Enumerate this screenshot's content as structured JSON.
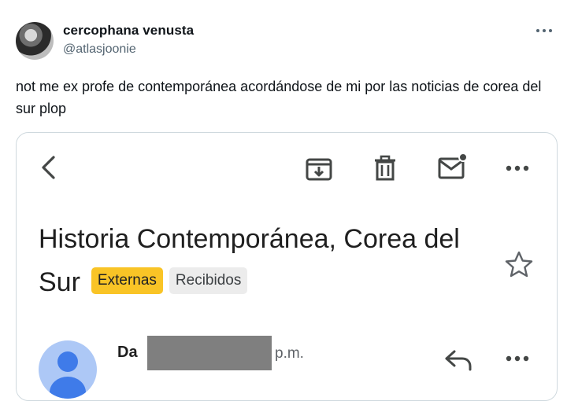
{
  "tweet": {
    "display_name": "cercophana venusta",
    "handle": "@atlasjoonie",
    "text": "not me ex profe de contemporánea acordándose de mi por las noticias de corea del sur plop"
  },
  "email": {
    "subject": "Historia Contemporánea, Corea del Sur",
    "labels": [
      {
        "text": "Externas",
        "color": "#f9c426"
      },
      {
        "text": "Recibidos",
        "color": "#ececec"
      }
    ],
    "sender_name_visible": "Da",
    "time_visible": "p.m."
  },
  "colors": {
    "text": "#0f1419",
    "secondary": "#536471",
    "card_border": "#cfd9de",
    "gmail_icon": "#444746"
  },
  "icons": [
    "avatar",
    "more-dots-icon",
    "back-arrow-icon",
    "archive-icon",
    "trash-icon",
    "mark-unread-icon",
    "reply-icon",
    "star-icon"
  ]
}
